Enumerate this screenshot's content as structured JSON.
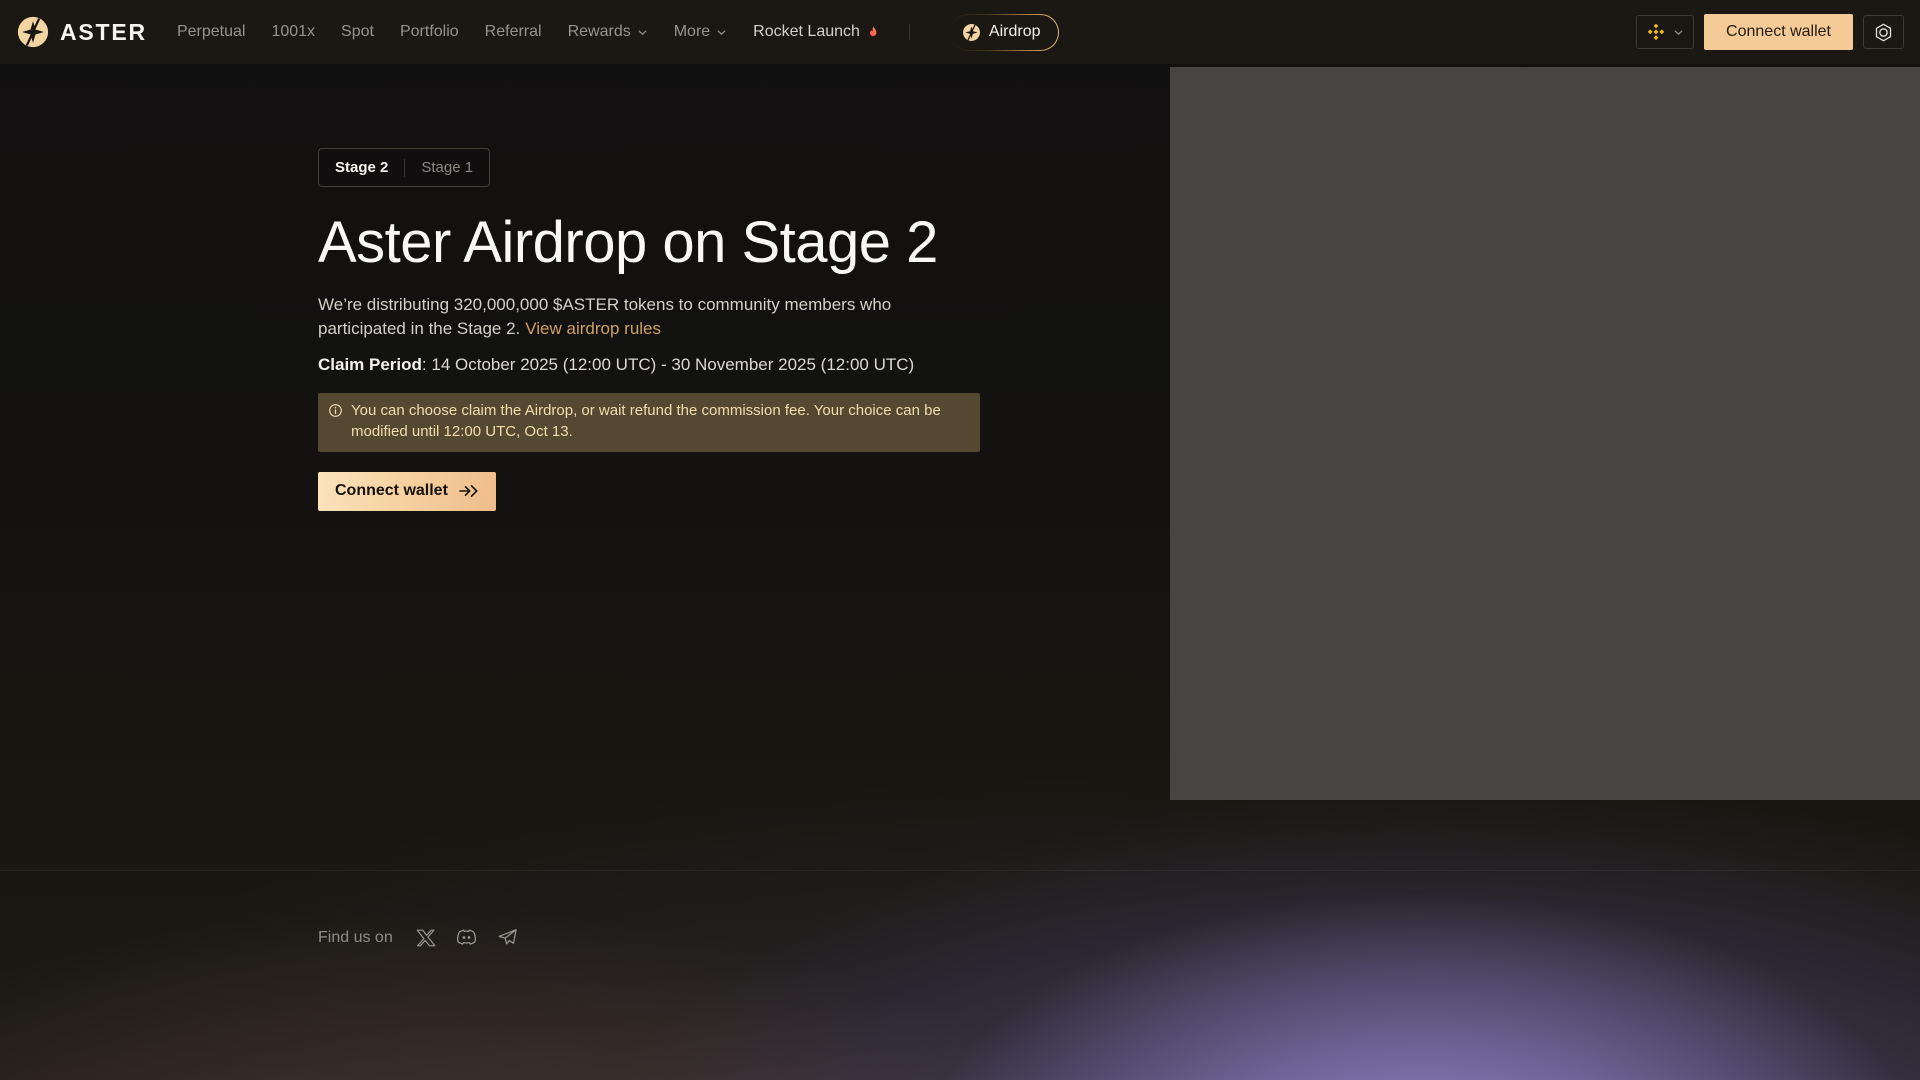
{
  "brand": {
    "name": "ASTER"
  },
  "nav": {
    "items": [
      {
        "label": "Perpetual"
      },
      {
        "label": "1001x"
      },
      {
        "label": "Spot"
      },
      {
        "label": "Portfolio"
      },
      {
        "label": "Referral"
      },
      {
        "label": "Rewards",
        "dropdown": true
      },
      {
        "label": "More",
        "dropdown": true
      },
      {
        "label": "Rocket Launch",
        "flame": true
      }
    ],
    "airdrop": {
      "label": "Airdrop"
    }
  },
  "header_actions": {
    "connect_wallet_label": "Connect wallet"
  },
  "hero": {
    "tabs": [
      {
        "label": "Stage 2",
        "active": true
      },
      {
        "label": "Stage 1",
        "active": false
      }
    ],
    "title": "Aster Airdrop on Stage 2",
    "description": "We’re distributing 320,000,000 $ASTER tokens to community members who participated in the Stage 2.",
    "rules_link": "View airdrop rules",
    "claim_period": {
      "label": "Claim Period",
      "value": ": 14 October 2025 (12:00 UTC) - 30 November 2025 (12:00 UTC)"
    },
    "notice": "You can choose claim the Airdrop, or wait refund the commission fee. Your choice can be modified until 12:00 UTC, Oct 13.",
    "cta_label": "Connect wallet"
  },
  "footer": {
    "find_us_label": "Find us on"
  },
  "icons": {
    "logo": "aster-logo-icon",
    "network": "bnb-chain-icon",
    "settings": "settings-gear-icon",
    "dropdown": "chevron-down-icon",
    "flame": "flame-icon",
    "notice": "info-icon",
    "cta": "arrow-right-icon",
    "social": [
      "x-twitter-icon",
      "discord-icon",
      "telegram-icon"
    ]
  },
  "colors": {
    "accent_peach": "#f4ca97",
    "cta_gradient_start": "#fbe3bc",
    "cta_gradient_end": "#eebd8a",
    "link_orange": "#cf9f63",
    "notice_bg": "#554830",
    "notice_text": "#f3dcb0",
    "bnb_yellow": "#F0B90B",
    "pill_gold": "#c79752",
    "placeholder_gray": "#464544",
    "nav_bg": "#1b1712",
    "purple_glow": "#9e90de"
  }
}
